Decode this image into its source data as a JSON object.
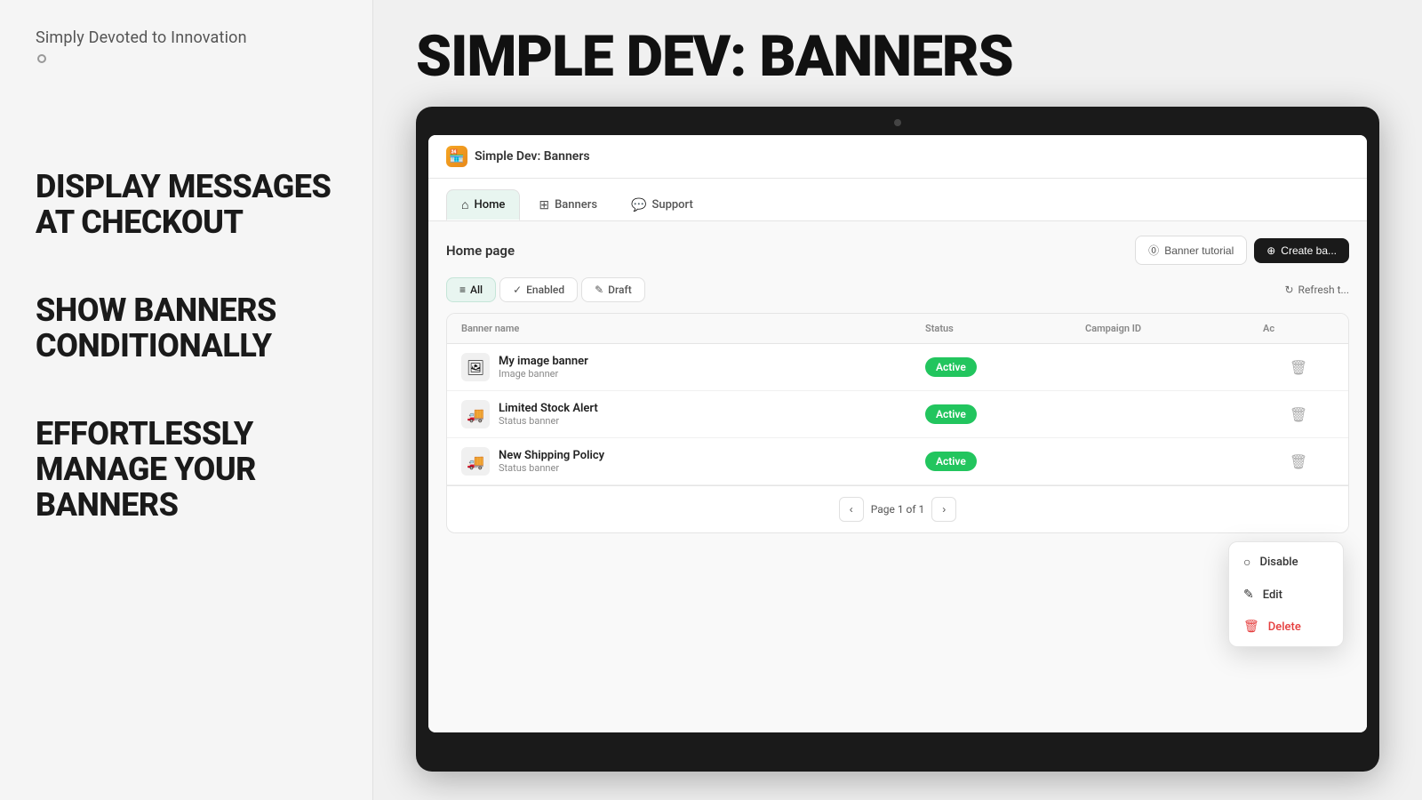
{
  "brand": {
    "name": "Simply Devoted to Innovation"
  },
  "features": [
    "DISPLAY MESSAGES\nAT CHECKOUT",
    "SHOW BANNERS\nCONDITIONALLY",
    "EFFORTLESSLY\nMANAGE YOUR\nBANNERS"
  ],
  "page_title": "SIMPLE DEV: BANNERS",
  "app": {
    "icon": "🏪",
    "title": "Simple Dev: Banners"
  },
  "nav_tabs": [
    {
      "label": "Home",
      "icon": "⌂",
      "active": true
    },
    {
      "label": "Banners",
      "icon": "⊞",
      "active": false
    },
    {
      "label": "Support",
      "icon": "💬",
      "active": false
    }
  ],
  "content_title": "Home page",
  "buttons": {
    "tutorial": "Banner tutorial",
    "create": "Create ba..."
  },
  "filter_tabs": [
    {
      "label": "All",
      "icon": "≡",
      "active": true
    },
    {
      "label": "Enabled",
      "icon": "✓",
      "active": false
    },
    {
      "label": "Draft",
      "icon": "✎",
      "active": false
    }
  ],
  "refresh_label": "Refresh t...",
  "table": {
    "columns": [
      "Banner name",
      "Status",
      "Campaign ID",
      "Ac"
    ],
    "rows": [
      {
        "icon": "🖼",
        "name": "My image banner",
        "type": "Image banner",
        "status": "Active",
        "campaign_id": ""
      },
      {
        "icon": "🚚",
        "name": "Limited Stock Alert",
        "type": "Status banner",
        "status": "Active",
        "campaign_id": ""
      },
      {
        "icon": "🚚",
        "name": "New Shipping Policy",
        "type": "Status banner",
        "status": "Active",
        "campaign_id": ""
      }
    ]
  },
  "pagination": {
    "page_text": "Page 1 of 1"
  },
  "context_menu": {
    "items": [
      {
        "label": "Disable",
        "icon": "○",
        "type": "normal"
      },
      {
        "label": "Edit",
        "icon": "✎",
        "type": "normal"
      },
      {
        "label": "Delete",
        "icon": "🗑",
        "type": "danger"
      }
    ]
  }
}
